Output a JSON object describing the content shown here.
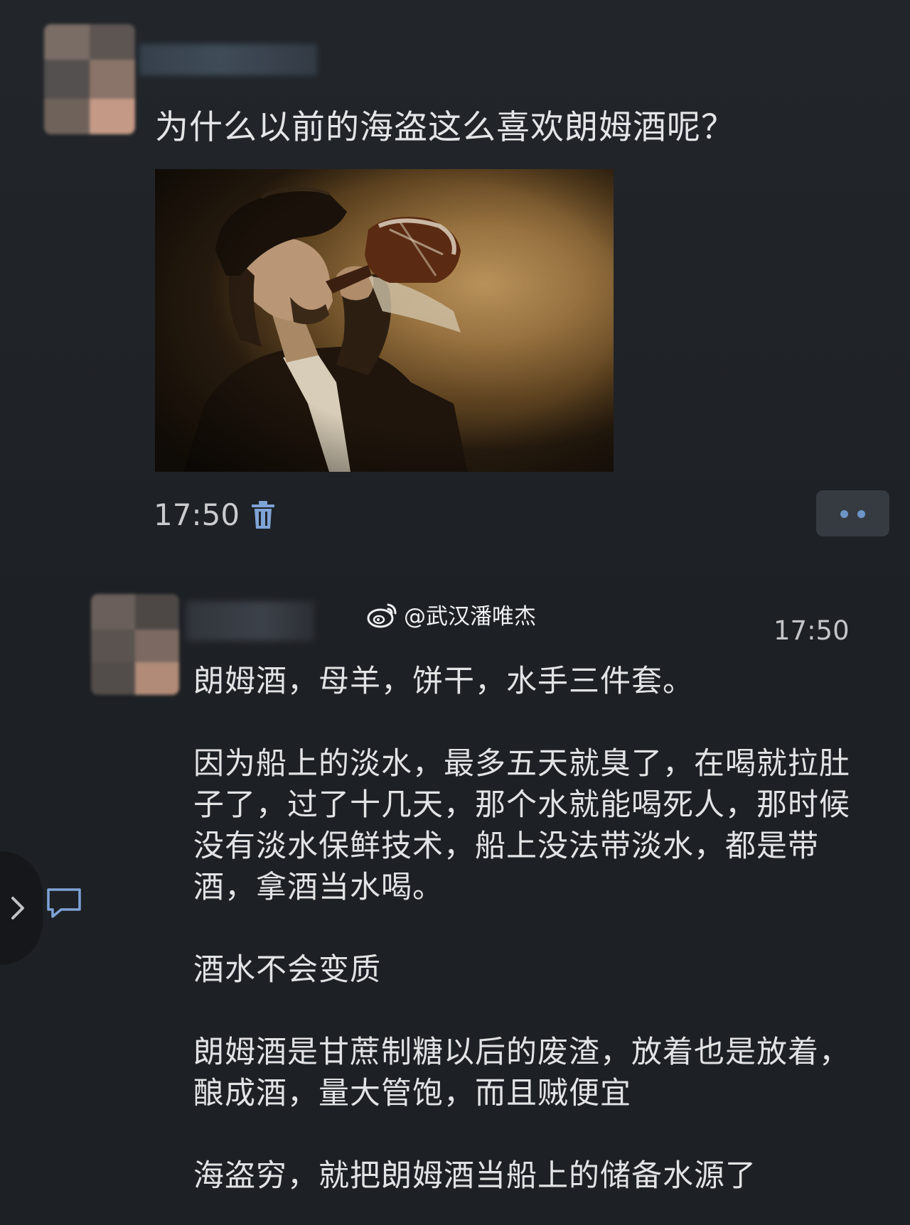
{
  "post": {
    "question": "为什么以前的海盗这么喜欢朗姆酒呢？",
    "time": "17:50",
    "icons": {
      "delete": "trash-icon",
      "more": "more-dots-icon"
    },
    "colors": {
      "accent": "#6e95c8",
      "background": "#1f2226"
    }
  },
  "comment": {
    "watermark": "@武汉潘唯杰",
    "time": "17:50",
    "paragraphs": [
      "朗姆酒，母羊，饼干，水手三件套。",
      "因为船上的淡水，最多五天就臭了，在喝就拉肚子了，过了十几天，那个水就能喝死人，那时候没有淡水保鲜技术，船上没法带淡水，都是带酒，拿酒当水喝。",
      "酒水不会变质",
      "朗姆酒是甘蔗制糖以后的废渣，放着也是放着，酿成酒，量大管饱，而且贼便宜",
      "海盗穷，就把朗姆酒当船上的储备水源了"
    ],
    "icons": {
      "watermark": "weibo-icon",
      "expand": "chevron-right-icon",
      "comment": "comment-bubble-icon"
    }
  }
}
